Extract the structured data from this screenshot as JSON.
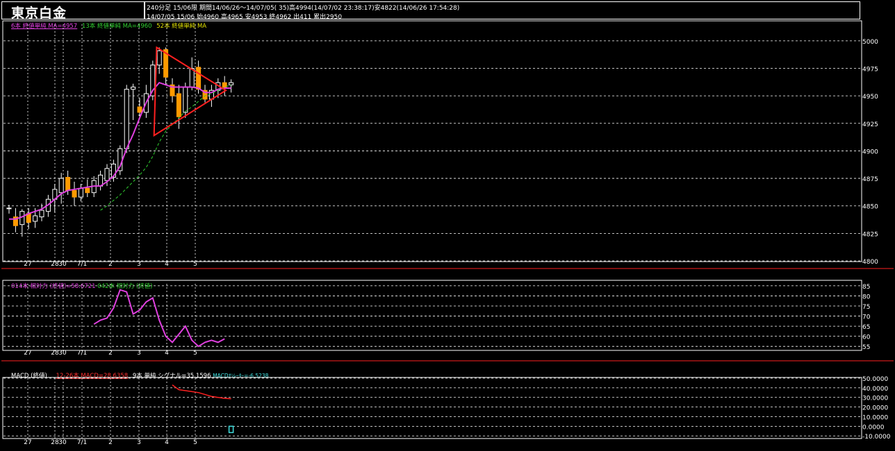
{
  "header": {
    "title": "東京白金",
    "info_line1": "240分足 15/06限 期間14/06/26～14/07/05( 35)高4994(14/07/02 23:38:17)安4822(14/06/26 17:54:28)",
    "info_line2": "14/07/05 15/06 始4960 高4965 安4953 終4962 出411 累出2950"
  },
  "legends": {
    "price": [
      {
        "text": "6本 終値単純 MA=4957",
        "color": "#e040e0"
      },
      {
        "text": "13本 終値単純 MA=4960",
        "color": "#30d030"
      },
      {
        "text": "52本 終値単純 MA",
        "color": "#e0e000"
      }
    ],
    "rsi": [
      {
        "text": "014本 相対力 (終値)=58.6721",
        "color": "#e040e0"
      },
      {
        "text": "042本 相対力 (終値)",
        "color": "#30d030"
      }
    ],
    "macd": [
      {
        "text": "MACD (終値)",
        "color": "#ffffff"
      },
      {
        "text": "12-26本 MACD=28.6358",
        "color": "#ff3030"
      },
      {
        "text": "9本 単純 シグナル=35.1596",
        "color": "#ffffff"
      },
      {
        "text": "MACDｵｼﾚｰﾀｰ=-6.5238",
        "color": "#40e0e0"
      }
    ]
  },
  "colors": {
    "background": "#000000",
    "grid": "#ffffff",
    "candle_up": "#ffffff",
    "candle_down": "#ff9a00",
    "ma6": "#e040e0",
    "ma13": "#30d030",
    "macd_line": "#ff2020",
    "triangle": "#ff2020",
    "panel_separator": "#ff2020",
    "histogram": "#40e0e0"
  },
  "chart_data": [
    {
      "type": "candlestick",
      "name": "price",
      "ylim": [
        4800,
        5010
      ],
      "y_ticks": [
        "5000",
        "4975",
        "4950",
        "4925",
        "4900",
        "4875",
        "4850",
        "4825",
        "4800"
      ],
      "x_ticks": [
        "27",
        "28",
        "30",
        "7/1",
        "2",
        "3",
        "4",
        "5"
      ],
      "candles": [
        {
          "o": 4848,
          "h": 4851,
          "l": 4843,
          "c": 4848
        },
        {
          "o": 4840,
          "h": 4848,
          "l": 4826,
          "c": 4832
        },
        {
          "o": 4833,
          "h": 4847,
          "l": 4822,
          "c": 4845
        },
        {
          "o": 4843,
          "h": 4848,
          "l": 4829,
          "c": 4835
        },
        {
          "o": 4836,
          "h": 4848,
          "l": 4830,
          "c": 4841
        },
        {
          "o": 4840,
          "h": 4852,
          "l": 4836,
          "c": 4846
        },
        {
          "o": 4845,
          "h": 4860,
          "l": 4840,
          "c": 4856
        },
        {
          "o": 4856,
          "h": 4870,
          "l": 4844,
          "c": 4865
        },
        {
          "o": 4862,
          "h": 4880,
          "l": 4852,
          "c": 4875
        },
        {
          "o": 4876,
          "h": 4882,
          "l": 4860,
          "c": 4864
        },
        {
          "o": 4864,
          "h": 4872,
          "l": 4850,
          "c": 4858
        },
        {
          "o": 4858,
          "h": 4870,
          "l": 4854,
          "c": 4866
        },
        {
          "o": 4866,
          "h": 4874,
          "l": 4858,
          "c": 4862
        },
        {
          "o": 4862,
          "h": 4877,
          "l": 4858,
          "c": 4873
        },
        {
          "o": 4868,
          "h": 4882,
          "l": 4864,
          "c": 4878
        },
        {
          "o": 4873,
          "h": 4888,
          "l": 4868,
          "c": 4884
        },
        {
          "o": 4876,
          "h": 4892,
          "l": 4872,
          "c": 4888
        },
        {
          "o": 4882,
          "h": 4905,
          "l": 4878,
          "c": 4902
        },
        {
          "o": 4902,
          "h": 4960,
          "l": 4898,
          "c": 4956
        },
        {
          "o": 4956,
          "h": 4961,
          "l": 4928,
          "c": 4958
        },
        {
          "o": 4940,
          "h": 4948,
          "l": 4930,
          "c": 4935
        },
        {
          "o": 4935,
          "h": 4960,
          "l": 4930,
          "c": 4952
        },
        {
          "o": 4950,
          "h": 4982,
          "l": 4946,
          "c": 4978
        },
        {
          "o": 4978,
          "h": 4994,
          "l": 4970,
          "c": 4991
        },
        {
          "o": 4992,
          "h": 4994,
          "l": 4960,
          "c": 4967
        },
        {
          "o": 4960,
          "h": 4966,
          "l": 4944,
          "c": 4950
        },
        {
          "o": 4952,
          "h": 4960,
          "l": 4920,
          "c": 4931
        },
        {
          "o": 4935,
          "h": 4962,
          "l": 4930,
          "c": 4958
        },
        {
          "o": 4958,
          "h": 4985,
          "l": 4955,
          "c": 4975
        },
        {
          "o": 4976,
          "h": 4982,
          "l": 4952,
          "c": 4956
        },
        {
          "o": 4955,
          "h": 4960,
          "l": 4944,
          "c": 4947
        },
        {
          "o": 4947,
          "h": 4960,
          "l": 4940,
          "c": 4955
        },
        {
          "o": 4955,
          "h": 4966,
          "l": 4948,
          "c": 4962
        },
        {
          "o": 4962,
          "h": 4968,
          "l": 4950,
          "c": 4958
        },
        {
          "o": 4960,
          "h": 4965,
          "l": 4953,
          "c": 4962
        }
      ],
      "ma6": [
        4838,
        4838,
        4840,
        4843,
        4845,
        4847,
        4851,
        4856,
        4861,
        4864,
        4865,
        4866,
        4867,
        4868,
        4868,
        4872,
        4877,
        4886,
        4902,
        4915,
        4930,
        4944,
        4955,
        4962,
        4960,
        4958,
        4958,
        4958,
        4958,
        4957,
        4953,
        4953,
        4956,
        4957,
        4957
      ],
      "ma13": [
        4846,
        4850,
        4855,
        4860,
        4866,
        4872,
        4878,
        4885,
        4895,
        4908,
        4918,
        4924,
        4930,
        4936,
        4940,
        4945,
        4950,
        4952,
        4955,
        4958,
        4960
      ],
      "ma13_start_index": 14
    },
    {
      "type": "line",
      "name": "rsi",
      "ylim": [
        53,
        86
      ],
      "y_ticks": [
        "85",
        "80",
        "75",
        "70",
        "65",
        "60",
        "55"
      ],
      "x_ticks": [
        "27",
        "28",
        "30",
        "7/1",
        "2",
        "3",
        "4",
        "5"
      ],
      "series": [
        {
          "name": "014本 相対力 (終値)",
          "start_index": 13,
          "values": [
            66,
            68,
            69,
            74,
            83,
            82,
            71,
            73,
            77,
            79,
            68,
            60,
            57,
            61,
            65,
            58,
            55,
            57,
            58,
            57,
            58.7
          ]
        }
      ]
    },
    {
      "type": "line",
      "name": "macd",
      "ylim": [
        -12,
        50
      ],
      "y_ticks": [
        "50.0000",
        "40.0000",
        "30.0000",
        "20.0000",
        "10.0000",
        "0.0000",
        "-10.0000"
      ],
      "x_ticks": [
        "27",
        "28",
        "30",
        "7/1",
        "2",
        "3",
        "4",
        "5"
      ],
      "series": [
        {
          "name": "12-26本 MACD",
          "start_index": 25,
          "values": [
            43,
            38,
            37,
            36,
            35,
            33,
            31,
            30,
            29,
            28.6
          ]
        }
      ],
      "histogram": {
        "index": 34,
        "value": -6.5238
      }
    }
  ]
}
